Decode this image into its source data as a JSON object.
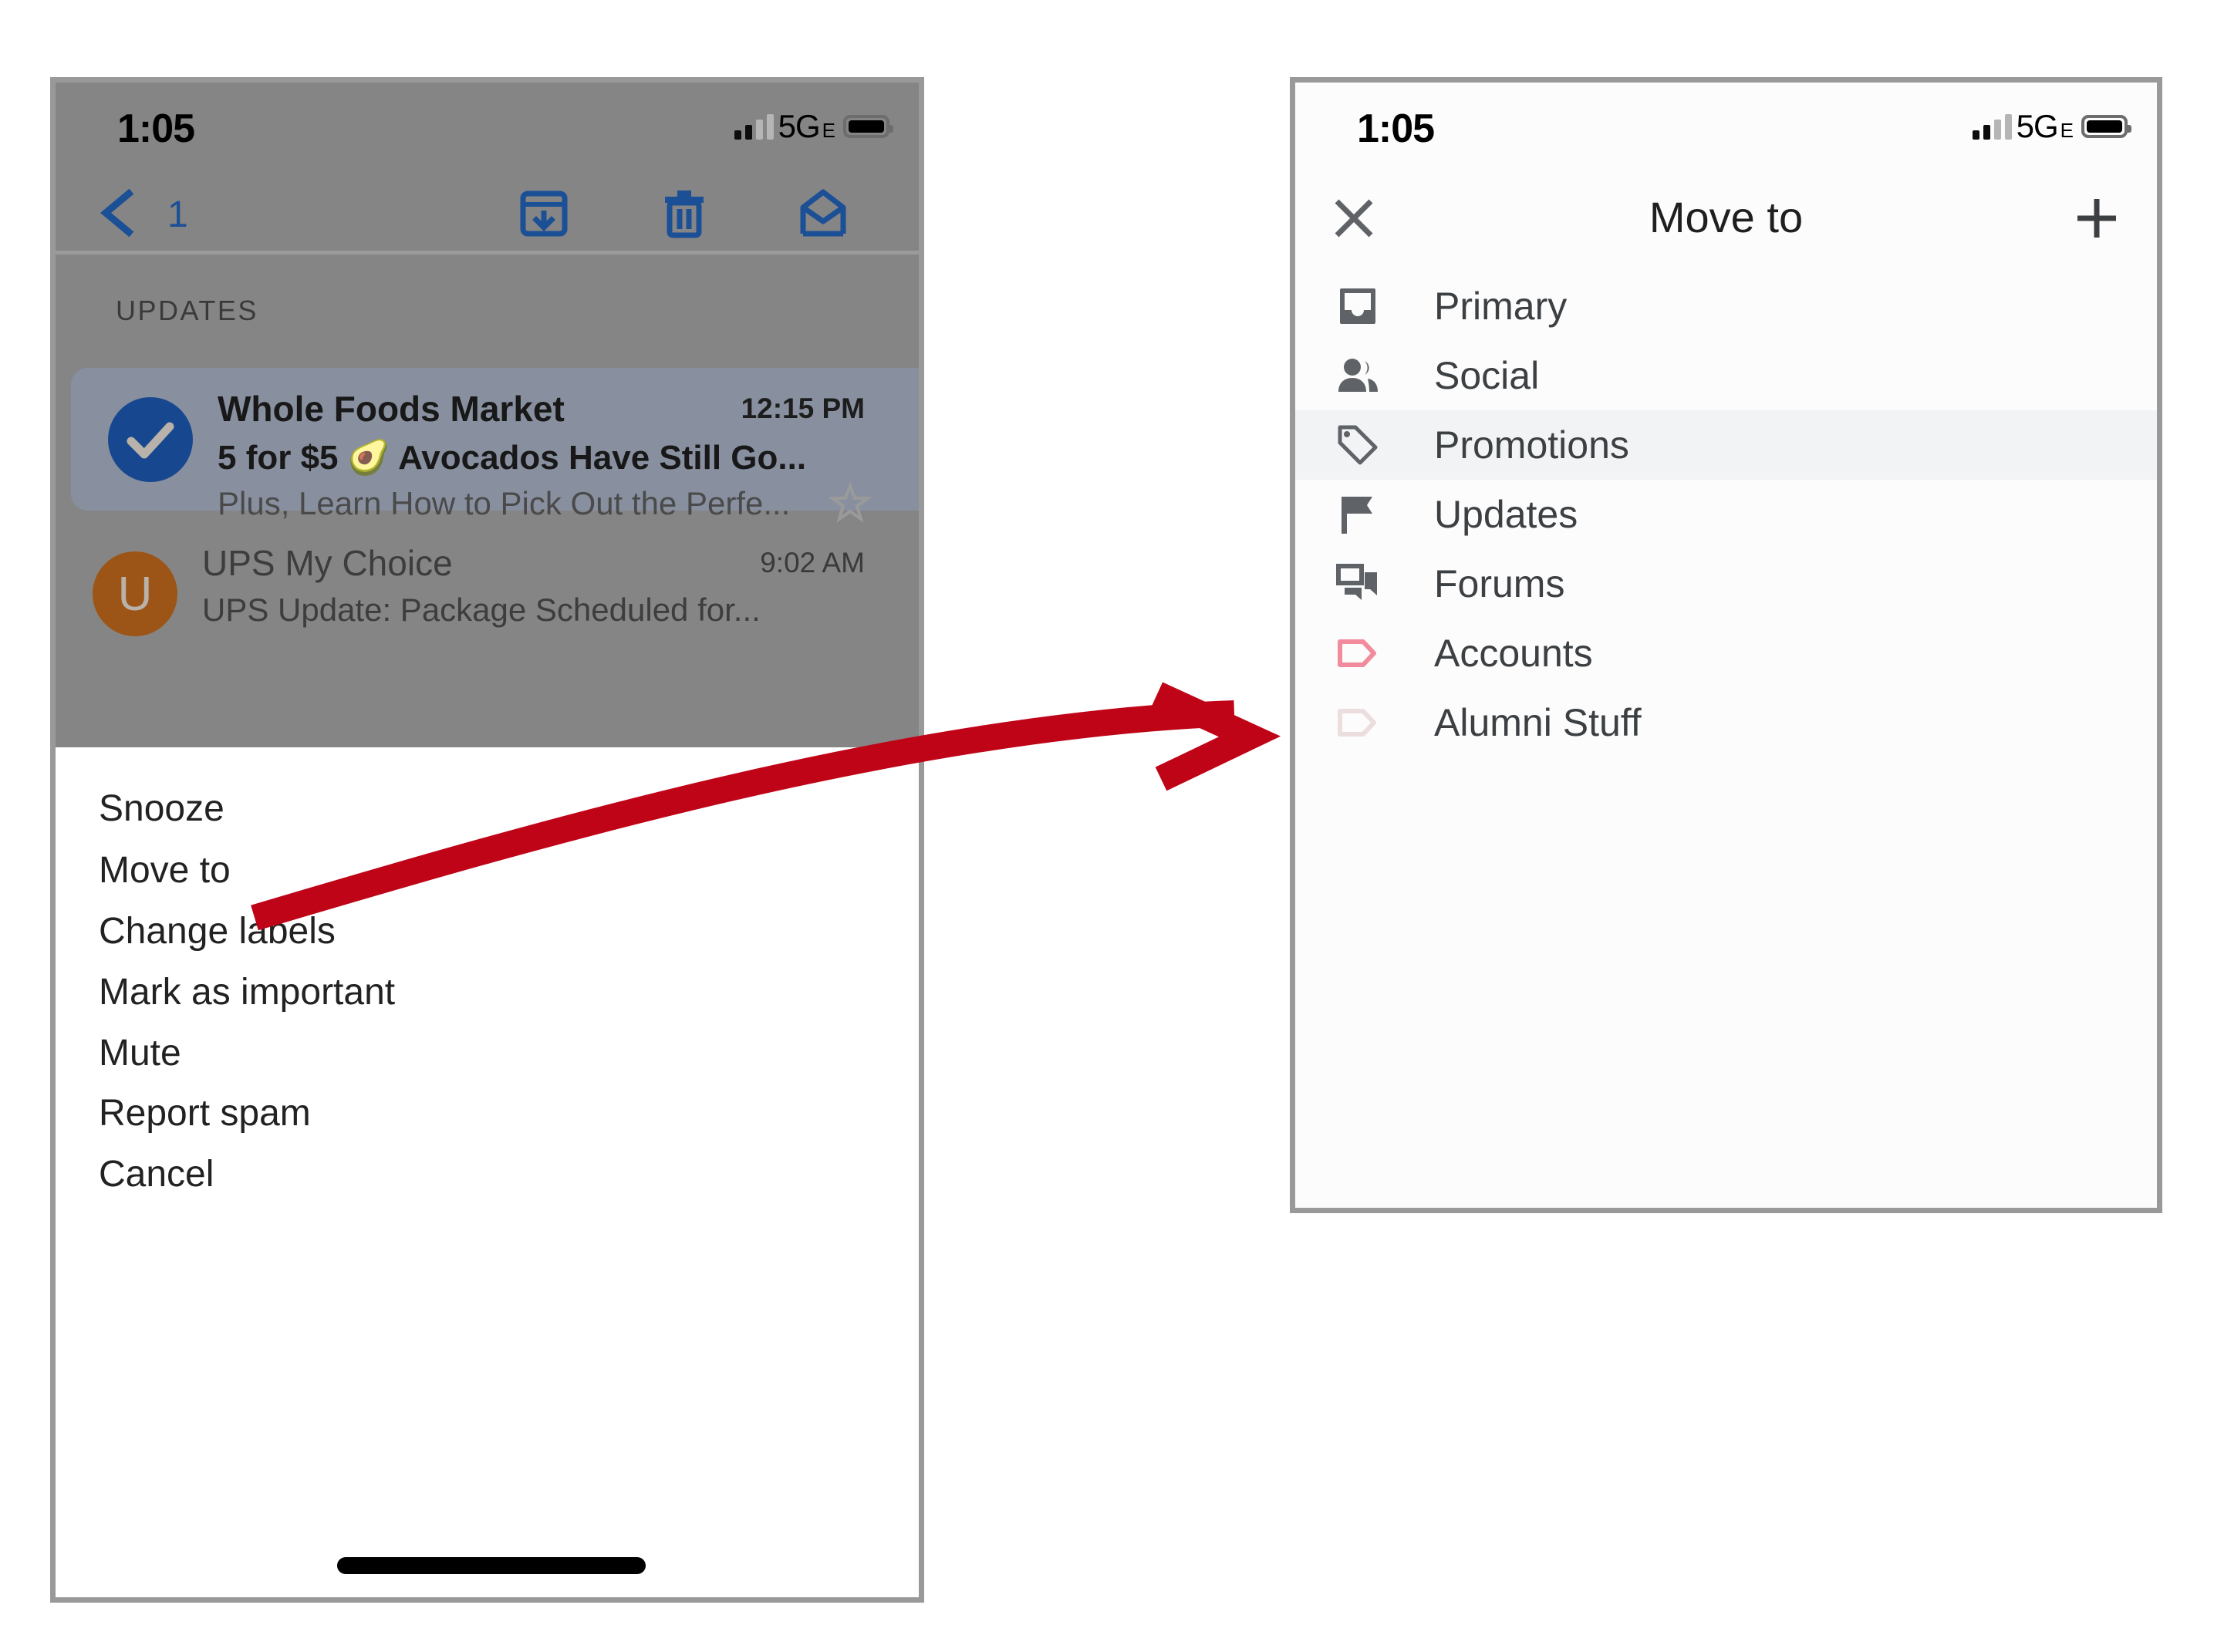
{
  "left_phone": {
    "status_bar": {
      "time": "1:05",
      "network": "5G",
      "network_suffix": "E",
      "signal_icon": "signal-bars-icon",
      "battery_icon": "battery-full-icon"
    },
    "toolbar": {
      "back_icon": "chevron-left-icon",
      "selected_count": "1",
      "archive_icon": "archive-icon",
      "delete_icon": "trash-icon",
      "mark_unread_icon": "open-envelope-icon",
      "more_icon": "more-horizontal-icon"
    },
    "section_label": "UPDATES",
    "messages": [
      {
        "sender": "Whole Foods Market",
        "time": "12:15 PM",
        "subject": "5 for $5 🥑 Avocados Have Still Go...",
        "snippet": "Plus, Learn How to Pick Out the Perfe...",
        "avatar_type": "checkmark",
        "avatar_letter": "",
        "avatar_color": "#17488f",
        "selected": true,
        "star_icon": "star-outline-icon"
      },
      {
        "sender": "UPS My Choice",
        "time": "9:02 AM",
        "subject": "UPS Update: Package Scheduled for...",
        "snippet": "",
        "avatar_type": "letter",
        "avatar_letter": "U",
        "avatar_color": "#9c5516",
        "selected": false,
        "star_icon": ""
      }
    ],
    "action_sheet": {
      "items": [
        "Snooze",
        "Move to",
        "Change labels",
        "Mark as important",
        "Mute",
        "Report spam",
        "Cancel"
      ]
    }
  },
  "right_phone": {
    "status_bar": {
      "time": "1:05",
      "network": "5G",
      "network_suffix": "E",
      "signal_icon": "signal-bars-icon",
      "battery_icon": "battery-full-icon"
    },
    "header": {
      "title": "Move to",
      "close_icon": "close-x-icon",
      "add_icon": "plus-icon"
    },
    "destinations": [
      {
        "label": "Primary",
        "icon": "inbox-icon",
        "color": "#5f6368",
        "highlighted": false
      },
      {
        "label": "Social",
        "icon": "people-icon",
        "color": "#5f6368",
        "highlighted": false
      },
      {
        "label": "Promotions",
        "icon": "price-tag-icon",
        "color": "#5f6368",
        "highlighted": true
      },
      {
        "label": "Updates",
        "icon": "flag-icon",
        "color": "#5f6368",
        "highlighted": false
      },
      {
        "label": "Forums",
        "icon": "forum-chat-icon",
        "color": "#5f6368",
        "highlighted": false
      },
      {
        "label": "Accounts",
        "icon": "label-outline-icon",
        "color": "#f28b9b",
        "highlighted": false
      },
      {
        "label": "Alumni Stuff",
        "icon": "label-outline-icon",
        "color": "#ecdede",
        "highlighted": false
      }
    ]
  },
  "annotation": {
    "arrow_icon": "curved-arrow-right-icon",
    "arrow_color": "#c00418"
  }
}
